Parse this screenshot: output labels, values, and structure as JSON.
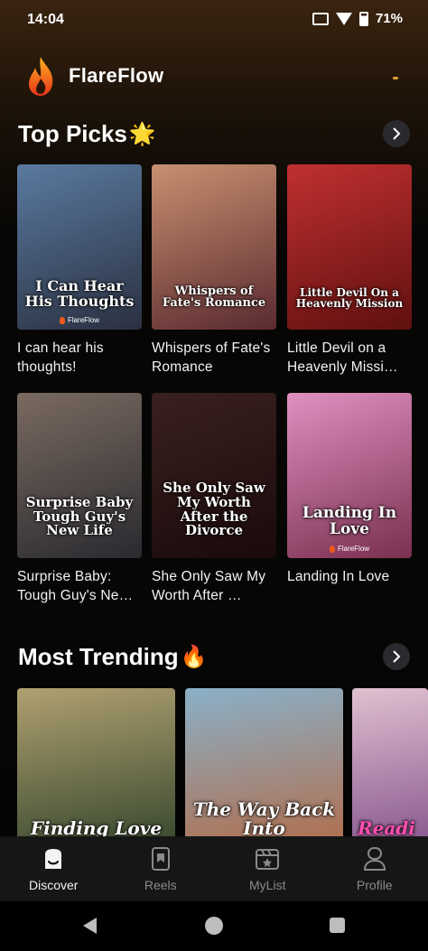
{
  "status_bar": {
    "time": "14:04",
    "battery": "71%"
  },
  "app": {
    "name": "FlareFlow"
  },
  "top_picks": {
    "title": "Top Picks",
    "emoji": "🌟",
    "items": [
      {
        "title": "I can hear his thoughts!",
        "poster_text": "I Can Hear His Thoughts",
        "badge": "FlareFlow",
        "colors": [
          "#5a7aa0",
          "#2a3040"
        ]
      },
      {
        "title": "Whispers of Fate's Romance",
        "poster_text": "Whispers of Fate's Romance",
        "colors": [
          "#c89070",
          "#5a2a30"
        ]
      },
      {
        "title": "Little Devil on a Heavenly Missi…",
        "poster_text": "Little Devil On a Heavenly Mission",
        "colors": [
          "#c03030",
          "#601010"
        ]
      },
      {
        "title": "Surprise Baby: Tough Guy's Ne…",
        "poster_text": "Surprise Baby Tough Guy's New Life",
        "colors": [
          "#7a6a60",
          "#2a2a30"
        ]
      },
      {
        "title": "She Only Saw My Worth After …",
        "poster_text": "She Only Saw My Worth After the Divorce",
        "colors": [
          "#3a2020",
          "#1a0a0a"
        ]
      },
      {
        "title": "Landing In Love",
        "poster_text": "Landing In Love",
        "badge": "FlareFlow",
        "colors": [
          "#e090c0",
          "#7a3050"
        ]
      }
    ]
  },
  "most_trending": {
    "title": "Most Trending",
    "emoji": "🔥",
    "items": [
      {
        "poster_text": "Finding Love",
        "colors": [
          "#b0a070",
          "#3a4a30"
        ]
      },
      {
        "poster_text": "The Way Back Into",
        "colors": [
          "#8ab0c8",
          "#b07050"
        ]
      },
      {
        "poster_text": "Readi",
        "colors": [
          "#e0c0d0",
          "#8a5a90"
        ]
      }
    ]
  },
  "bottom_nav": {
    "items": [
      {
        "label": "Discover",
        "icon": "discover-icon",
        "active": true
      },
      {
        "label": "Reels",
        "icon": "reels-icon",
        "active": false
      },
      {
        "label": "MyList",
        "icon": "mylist-icon",
        "active": false
      },
      {
        "label": "Profile",
        "icon": "profile-icon",
        "active": false
      }
    ]
  }
}
